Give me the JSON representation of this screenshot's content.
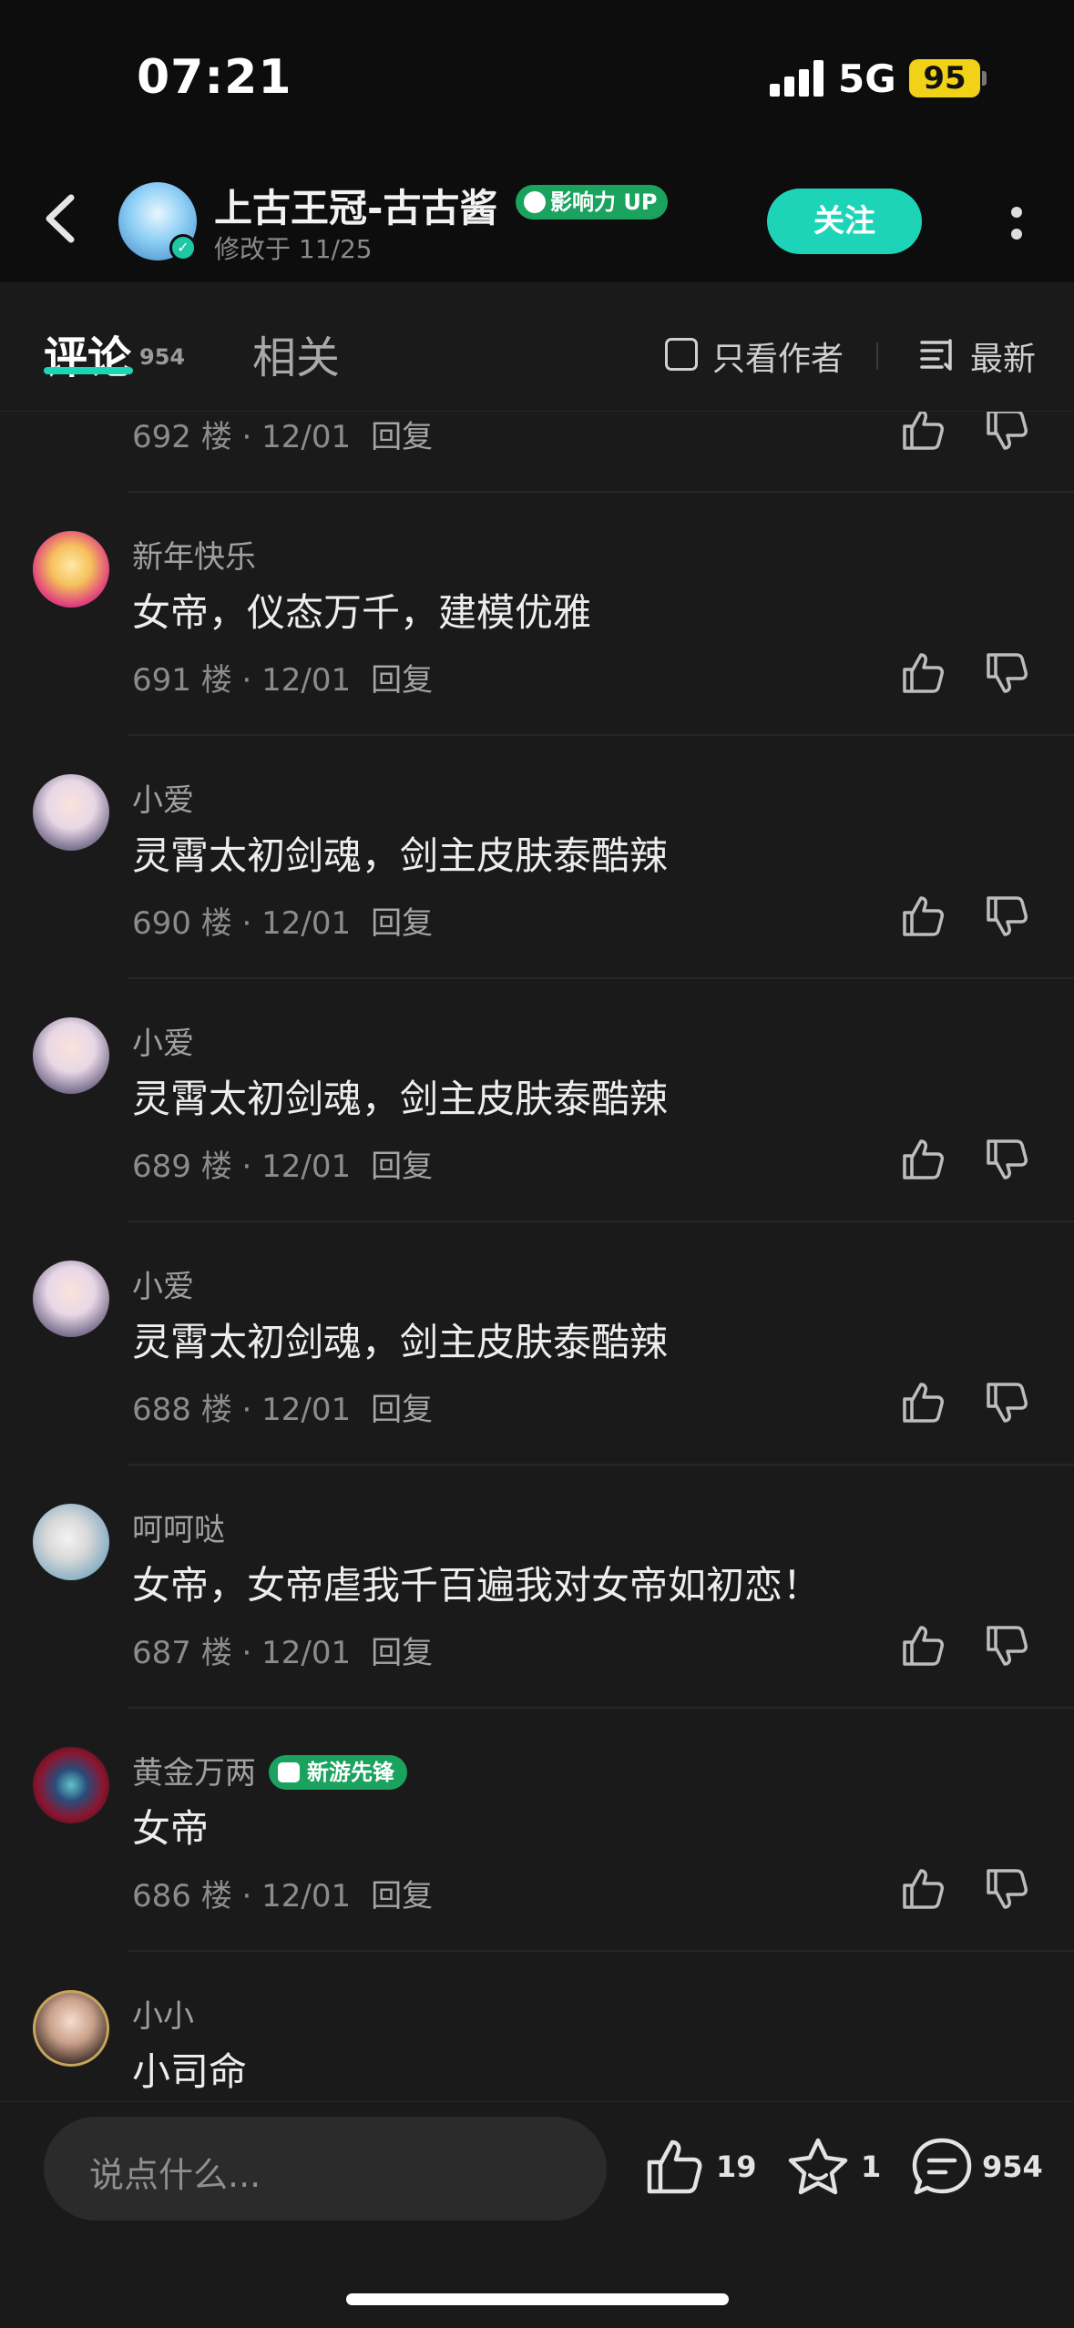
{
  "status_bar": {
    "time": "07:21",
    "network": "5G",
    "battery": "95"
  },
  "header": {
    "author_name": "上古王冠-古古酱",
    "badge": "影响力 UP",
    "modified": "修改于 11/25",
    "follow_label": "关注"
  },
  "tabs": {
    "comments_label": "评论",
    "comments_count": "954",
    "related_label": "相关",
    "author_only_label": "只看作者",
    "sort_label": "最新"
  },
  "partial_top_comment": {
    "meta": "692 楼 · 12/01",
    "reply": "回复"
  },
  "comments": [
    {
      "user": "新年快乐",
      "text": "女帝，仪态万千，建模优雅",
      "meta": "691 楼 · 12/01",
      "reply": "回复"
    },
    {
      "user": "小爱",
      "text": "灵霄太初剑魂，剑主皮肤泰酷辣",
      "meta": "690 楼 · 12/01",
      "reply": "回复"
    },
    {
      "user": "小爱",
      "text": "灵霄太初剑魂，剑主皮肤泰酷辣",
      "meta": "689 楼 · 12/01",
      "reply": "回复"
    },
    {
      "user": "小爱",
      "text": "灵霄太初剑魂，剑主皮肤泰酷辣",
      "meta": "688 楼 · 12/01",
      "reply": "回复"
    },
    {
      "user": "呵呵哒",
      "text": "女帝，女帝虐我千百遍我对女帝如初恋！",
      "meta": "687 楼 · 12/01",
      "reply": "回复"
    },
    {
      "user": "黄金万两",
      "badge": "新游先锋",
      "text": "女帝",
      "meta": "686 楼 · 12/01",
      "reply": "回复"
    },
    {
      "user": "小小",
      "text": "小司命"
    }
  ],
  "bottom_bar": {
    "placeholder": "说点什么...",
    "likes": "19",
    "stars": "1",
    "comments": "954"
  }
}
